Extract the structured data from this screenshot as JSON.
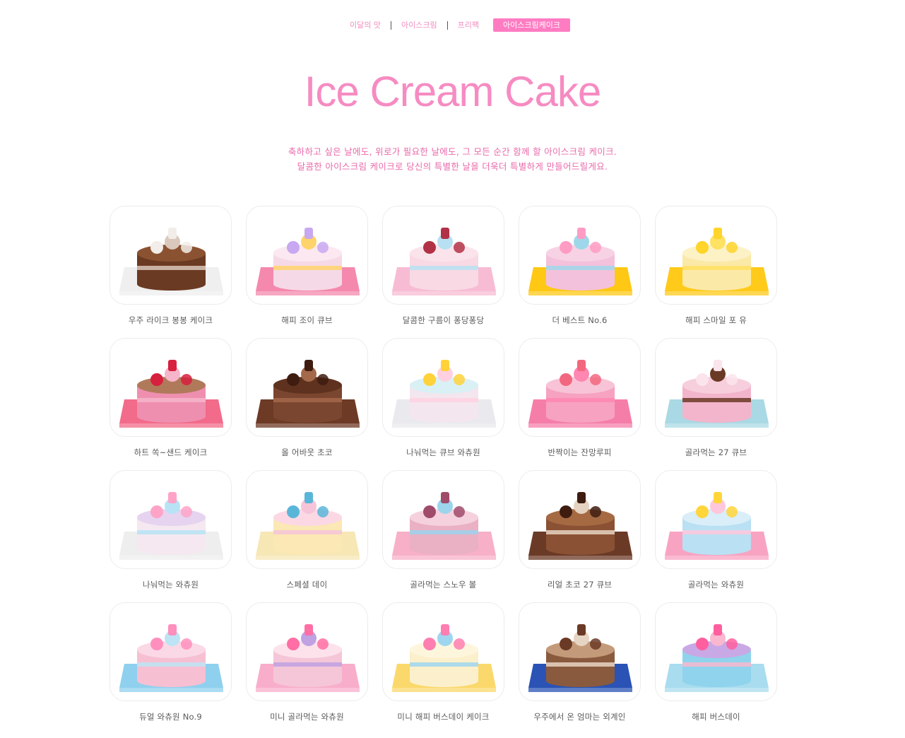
{
  "subnav": {
    "items": [
      "이달의 맛",
      "아이스크림",
      "프리팩"
    ],
    "active": "아이스크림케이크"
  },
  "page": {
    "title": "Ice Cream Cake",
    "intro_line1": "축하하고 싶은 날에도, 위로가 필요한 날에도, 그 모든 순간 함께 할 아이스크림 케이크.",
    "intro_line2": "달콤한 아이스크림 케이크로 당신의 특별한 날을 더욱더 특별하게 만들어드릴게요."
  },
  "colors": {
    "accent": "#f68bc2",
    "nav_active": "#ff7cc3",
    "intro_text": "#ea6aaa"
  },
  "products": [
    {
      "name": "우주 라이크 봉봉 케이크",
      "board": "#efefef",
      "body": "#6b3a22",
      "top": "#8b5232",
      "stripe": "#d9c8bb",
      "deco": "#f2ede8"
    },
    {
      "name": "해피 조이 큐브",
      "board": "#f489ad",
      "body": "#f6d9e6",
      "top": "#fbe8f0",
      "stripe": "#ffd36b",
      "deco": "#c8a8f0"
    },
    {
      "name": "달콤한 구름이 퐁당퐁당",
      "board": "#f7bcd3",
      "body": "#f8d9e4",
      "top": "#fbe3ec",
      "stripe": "#b7e0f2",
      "deco": "#b13246"
    },
    {
      "name": "더 베스트 No.6",
      "board": "#ffc814",
      "body": "#f3c1db",
      "top": "#f7d2e4",
      "stripe": "#9fd7ea",
      "deco": "#ff9cc4"
    },
    {
      "name": "해피 스마일 포 유",
      "board": "#ffca1a",
      "body": "#fbe9a8",
      "top": "#fdf2c6",
      "stripe": "#ffe163",
      "deco": "#ffd42b"
    },
    {
      "name": "하트 쏙~샌드 케이크",
      "board": "#f26b8a",
      "body": "#ef8fb0",
      "top": "#b07a5a",
      "stripe": "#f6b5ca",
      "deco": "#d6203e"
    },
    {
      "name": "올 어바웃 초코",
      "board": "#6d3a26",
      "body": "#7b4630",
      "top": "#5f321f",
      "stripe": "#a4694a",
      "deco": "#3e1c10"
    },
    {
      "name": "나눠먹는 큐브 와츄원",
      "board": "#e9e9ee",
      "body": "#f4e6ee",
      "top": "#d9f0f5",
      "stripe": "#ffd1e0",
      "deco": "#ffd23a"
    },
    {
      "name": "반짝이는 잔망루피",
      "board": "#f57ea9",
      "body": "#f6a2c0",
      "top": "#f8c3d6",
      "stripe": "#ff87b2",
      "deco": "#f2677f"
    },
    {
      "name": "골라먹는 27 큐브",
      "board": "#a9d9e4",
      "body": "#f2b5cc",
      "top": "#f7cedc",
      "stripe": "#6b3a26",
      "deco": "#fbe4ec"
    },
    {
      "name": "나눠먹는 와츄원",
      "board": "#eeeeee",
      "body": "#f5e8f0",
      "top": "#e5d3f0",
      "stripe": "#b7e3f5",
      "deco": "#ffa3c7"
    },
    {
      "name": "스페셜 데이",
      "board": "#f6e7b5",
      "body": "#fbe8b4",
      "top": "#fcd8e5",
      "stripe": "#f5c4d8",
      "deco": "#5ab6d9"
    },
    {
      "name": "골라먹는 스노우 볼",
      "board": "#f7b0c8",
      "body": "#eab0c4",
      "top": "#f5d1de",
      "stripe": "#9cd4ec",
      "deco": "#a04b6a"
    },
    {
      "name": "리얼 초코 27 큐브",
      "board": "#6b3a26",
      "body": "#8a5134",
      "top": "#a56a42",
      "stripe": "#e5d2c1",
      "deco": "#3e1c10"
    },
    {
      "name": "골라먹는 와츄원",
      "board": "#f8a3c2",
      "body": "#b9e0f3",
      "top": "#d9eef8",
      "stripe": "#ffc7dc",
      "deco": "#ffd53a"
    },
    {
      "name": "듀얼 와츄원 No.9",
      "board": "#8fd0ee",
      "body": "#f6bfd2",
      "top": "#fbd8e5",
      "stripe": "#bde4f4",
      "deco": "#ff8fbd"
    },
    {
      "name": "미니 골라먹는 와츄원",
      "board": "#f8aecb",
      "body": "#f5c6d7",
      "top": "#fde2ec",
      "stripe": "#c0a1e2",
      "deco": "#ff6fa5"
    },
    {
      "name": "미니 해피 버스데이 케이크",
      "board": "#fbd86b",
      "body": "#fbf0cb",
      "top": "#fdf6dd",
      "stripe": "#9fd6ef",
      "deco": "#ff7eb1"
    },
    {
      "name": "우주에서 온 엄마는 외계인",
      "board": "#2a53b5",
      "body": "#8a5a3e",
      "top": "#c49b7a",
      "stripe": "#e7d5c3",
      "deco": "#6b3a26"
    },
    {
      "name": "해피 버스데이",
      "board": "#a9dcef",
      "body": "#8fd4ec",
      "top": "#c9a8e6",
      "stripe": "#f9b7d0",
      "deco": "#ff5f9e"
    }
  ]
}
